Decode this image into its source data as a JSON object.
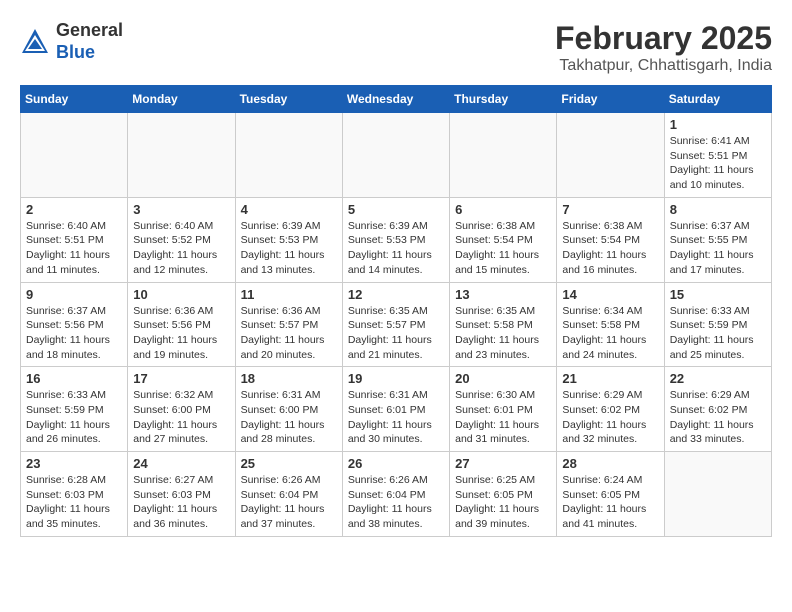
{
  "header": {
    "logo_general": "General",
    "logo_blue": "Blue",
    "month_title": "February 2025",
    "location": "Takhatpur, Chhattisgarh, India"
  },
  "weekdays": [
    "Sunday",
    "Monday",
    "Tuesday",
    "Wednesday",
    "Thursday",
    "Friday",
    "Saturday"
  ],
  "weeks": [
    [
      {
        "day": "",
        "info": ""
      },
      {
        "day": "",
        "info": ""
      },
      {
        "day": "",
        "info": ""
      },
      {
        "day": "",
        "info": ""
      },
      {
        "day": "",
        "info": ""
      },
      {
        "day": "",
        "info": ""
      },
      {
        "day": "1",
        "info": "Sunrise: 6:41 AM\nSunset: 5:51 PM\nDaylight: 11 hours\nand 10 minutes."
      }
    ],
    [
      {
        "day": "2",
        "info": "Sunrise: 6:40 AM\nSunset: 5:51 PM\nDaylight: 11 hours\nand 11 minutes."
      },
      {
        "day": "3",
        "info": "Sunrise: 6:40 AM\nSunset: 5:52 PM\nDaylight: 11 hours\nand 12 minutes."
      },
      {
        "day": "4",
        "info": "Sunrise: 6:39 AM\nSunset: 5:53 PM\nDaylight: 11 hours\nand 13 minutes."
      },
      {
        "day": "5",
        "info": "Sunrise: 6:39 AM\nSunset: 5:53 PM\nDaylight: 11 hours\nand 14 minutes."
      },
      {
        "day": "6",
        "info": "Sunrise: 6:38 AM\nSunset: 5:54 PM\nDaylight: 11 hours\nand 15 minutes."
      },
      {
        "day": "7",
        "info": "Sunrise: 6:38 AM\nSunset: 5:54 PM\nDaylight: 11 hours\nand 16 minutes."
      },
      {
        "day": "8",
        "info": "Sunrise: 6:37 AM\nSunset: 5:55 PM\nDaylight: 11 hours\nand 17 minutes."
      }
    ],
    [
      {
        "day": "9",
        "info": "Sunrise: 6:37 AM\nSunset: 5:56 PM\nDaylight: 11 hours\nand 18 minutes."
      },
      {
        "day": "10",
        "info": "Sunrise: 6:36 AM\nSunset: 5:56 PM\nDaylight: 11 hours\nand 19 minutes."
      },
      {
        "day": "11",
        "info": "Sunrise: 6:36 AM\nSunset: 5:57 PM\nDaylight: 11 hours\nand 20 minutes."
      },
      {
        "day": "12",
        "info": "Sunrise: 6:35 AM\nSunset: 5:57 PM\nDaylight: 11 hours\nand 21 minutes."
      },
      {
        "day": "13",
        "info": "Sunrise: 6:35 AM\nSunset: 5:58 PM\nDaylight: 11 hours\nand 23 minutes."
      },
      {
        "day": "14",
        "info": "Sunrise: 6:34 AM\nSunset: 5:58 PM\nDaylight: 11 hours\nand 24 minutes."
      },
      {
        "day": "15",
        "info": "Sunrise: 6:33 AM\nSunset: 5:59 PM\nDaylight: 11 hours\nand 25 minutes."
      }
    ],
    [
      {
        "day": "16",
        "info": "Sunrise: 6:33 AM\nSunset: 5:59 PM\nDaylight: 11 hours\nand 26 minutes."
      },
      {
        "day": "17",
        "info": "Sunrise: 6:32 AM\nSunset: 6:00 PM\nDaylight: 11 hours\nand 27 minutes."
      },
      {
        "day": "18",
        "info": "Sunrise: 6:31 AM\nSunset: 6:00 PM\nDaylight: 11 hours\nand 28 minutes."
      },
      {
        "day": "19",
        "info": "Sunrise: 6:31 AM\nSunset: 6:01 PM\nDaylight: 11 hours\nand 30 minutes."
      },
      {
        "day": "20",
        "info": "Sunrise: 6:30 AM\nSunset: 6:01 PM\nDaylight: 11 hours\nand 31 minutes."
      },
      {
        "day": "21",
        "info": "Sunrise: 6:29 AM\nSunset: 6:02 PM\nDaylight: 11 hours\nand 32 minutes."
      },
      {
        "day": "22",
        "info": "Sunrise: 6:29 AM\nSunset: 6:02 PM\nDaylight: 11 hours\nand 33 minutes."
      }
    ],
    [
      {
        "day": "23",
        "info": "Sunrise: 6:28 AM\nSunset: 6:03 PM\nDaylight: 11 hours\nand 35 minutes."
      },
      {
        "day": "24",
        "info": "Sunrise: 6:27 AM\nSunset: 6:03 PM\nDaylight: 11 hours\nand 36 minutes."
      },
      {
        "day": "25",
        "info": "Sunrise: 6:26 AM\nSunset: 6:04 PM\nDaylight: 11 hours\nand 37 minutes."
      },
      {
        "day": "26",
        "info": "Sunrise: 6:26 AM\nSunset: 6:04 PM\nDaylight: 11 hours\nand 38 minutes."
      },
      {
        "day": "27",
        "info": "Sunrise: 6:25 AM\nSunset: 6:05 PM\nDaylight: 11 hours\nand 39 minutes."
      },
      {
        "day": "28",
        "info": "Sunrise: 6:24 AM\nSunset: 6:05 PM\nDaylight: 11 hours\nand 41 minutes."
      },
      {
        "day": "",
        "info": ""
      }
    ]
  ]
}
